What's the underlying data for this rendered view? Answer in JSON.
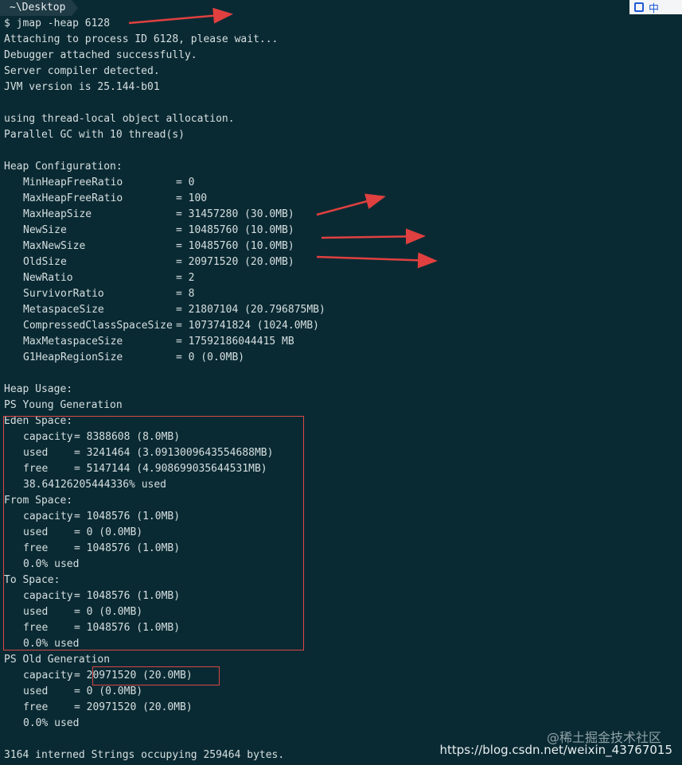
{
  "window": {
    "tab_title": "~\\Desktop"
  },
  "ime": {
    "mode": "中"
  },
  "terminal": {
    "command": "$ jmap -heap 6128",
    "intro": [
      "Attaching to process ID 6128, please wait...",
      "Debugger attached successfully.",
      "Server compiler detected.",
      "JVM version is 25.144-b01",
      "",
      "using thread-local object allocation.",
      "Parallel GC with 10 thread(s)",
      ""
    ],
    "heap_config_title": "Heap Configuration:",
    "heap_config": [
      {
        "key": "MinHeapFreeRatio",
        "value": "= 0"
      },
      {
        "key": "MaxHeapFreeRatio",
        "value": "= 100"
      },
      {
        "key": "MaxHeapSize",
        "value": "= 31457280 (30.0MB)"
      },
      {
        "key": "NewSize",
        "value": "= 10485760 (10.0MB)"
      },
      {
        "key": "MaxNewSize",
        "value": "= 10485760 (10.0MB)"
      },
      {
        "key": "OldSize",
        "value": "= 20971520 (20.0MB)"
      },
      {
        "key": "NewRatio",
        "value": "= 2"
      },
      {
        "key": "SurvivorRatio",
        "value": "= 8"
      },
      {
        "key": "MetaspaceSize",
        "value": "= 21807104 (20.796875MB)"
      },
      {
        "key": "CompressedClassSpaceSize",
        "value": "= 1073741824 (1024.0MB)"
      },
      {
        "key": "MaxMetaspaceSize",
        "value": "= 17592186044415 MB"
      },
      {
        "key": "G1HeapRegionSize",
        "value": "= 0 (0.0MB)"
      }
    ],
    "heap_usage_title": "Heap Usage:",
    "young_gen_title": "PS Young Generation",
    "eden": {
      "title": "Eden Space:",
      "rows": [
        {
          "key": "capacity",
          "value": "= 8388608 (8.0MB)"
        },
        {
          "key": "used",
          "value": "= 3241464 (3.0913009643554688MB)"
        },
        {
          "key": "free",
          "value": "= 5147144 (4.908699035644531MB)"
        }
      ],
      "used_pct": "38.64126205444336% used"
    },
    "from": {
      "title": "From Space:",
      "rows": [
        {
          "key": "capacity",
          "value": "= 1048576 (1.0MB)"
        },
        {
          "key": "used",
          "value": "= 0 (0.0MB)"
        },
        {
          "key": "free",
          "value": "= 1048576 (1.0MB)"
        }
      ],
      "used_pct": "0.0% used"
    },
    "to": {
      "title": "To Space:",
      "rows": [
        {
          "key": "capacity",
          "value": "= 1048576 (1.0MB)"
        },
        {
          "key": "used",
          "value": "= 0 (0.0MB)"
        },
        {
          "key": "free",
          "value": "= 1048576 (1.0MB)"
        }
      ],
      "used_pct": "0.0% used"
    },
    "old_gen": {
      "title": "PS Old Generation",
      "rows": [
        {
          "key": "capacity",
          "value": "= 20971520 (20.0MB)"
        },
        {
          "key": "used",
          "value": "= 0 (0.0MB)"
        },
        {
          "key": "free",
          "value": "= 20971520 (20.0MB)"
        }
      ],
      "used_pct": "0.0% used"
    },
    "strings_line": "3164 interned Strings occupying 259464 bytes."
  },
  "watermark": {
    "line1": "@稀土掘金技术社区",
    "line2": "https://blog.csdn.net/weixin_43767015"
  },
  "colors": {
    "background": "#0a2a33",
    "text": "#d6dfe0",
    "annotation": "#d94747"
  }
}
